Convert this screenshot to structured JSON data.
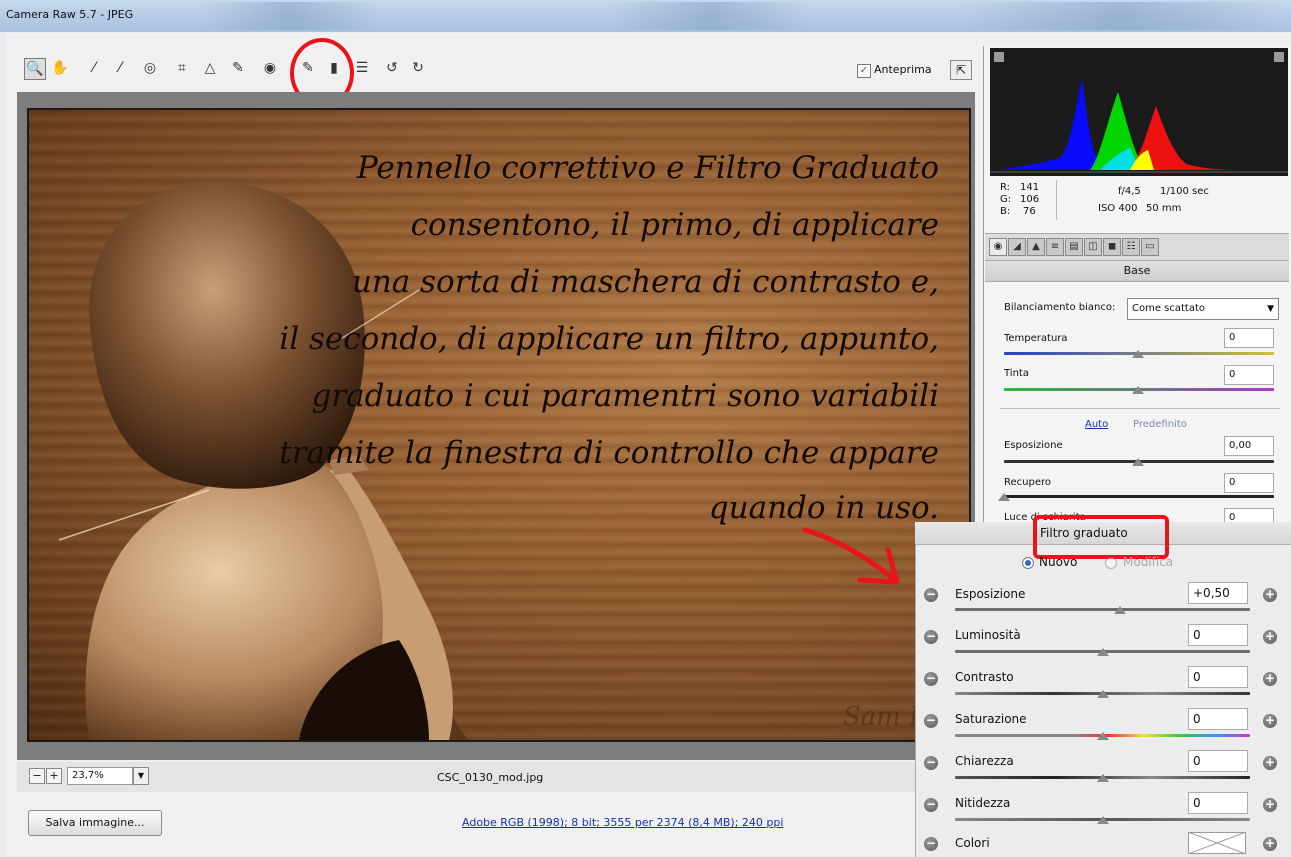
{
  "window": {
    "title": "Camera Raw 5.7  -  JPEG"
  },
  "toolbar": {
    "tools": [
      {
        "name": "zoom-tool",
        "glyph": "🔍"
      },
      {
        "name": "hand-tool",
        "glyph": "✋"
      },
      {
        "name": "white-balance-tool",
        "glyph": "⁄"
      },
      {
        "name": "color-sampler-tool",
        "glyph": "⁄"
      },
      {
        "name": "targeted-adjustment-tool",
        "glyph": "◎"
      },
      {
        "name": "crop-tool",
        "glyph": "⌗"
      },
      {
        "name": "straighten-tool",
        "glyph": "△"
      },
      {
        "name": "spot-removal-tool",
        "glyph": "✎"
      },
      {
        "name": "red-eye-tool",
        "glyph": "◉"
      },
      {
        "name": "adjustment-brush-tool",
        "glyph": "✎"
      },
      {
        "name": "graduated-filter-tool",
        "glyph": "▮"
      },
      {
        "name": "preferences-tool",
        "glyph": "☰"
      },
      {
        "name": "rotate-ccw-tool",
        "glyph": "↺"
      },
      {
        "name": "rotate-cw-tool",
        "glyph": "↻"
      }
    ],
    "preview_label": "Anteprima",
    "preview_checked": "✓"
  },
  "canvas": {
    "caption_lines": [
      "Pennello correttivo e Filtro Graduato",
      "consentono, il primo, di applicare",
      "una sorta di maschera di contrasto e,",
      "il secondo, di applicare un filtro, appunto,",
      "graduato i cui paramentri sono variabili",
      "tramite la finestra di controllo che appare",
      "quando in uso."
    ],
    "signature": "Sam DiG",
    "zoom_value": "23,7%",
    "filename": "CSC_0130_mod.jpg"
  },
  "footer": {
    "save_label": "Salva immagine...",
    "workflow_link": "Adobe RGB (1998); 8 bit; 3555 per 2374 (8,4 MB); 240 ppi"
  },
  "readout": {
    "r_label": "R:",
    "r_value": "141",
    "g_label": "G:",
    "g_value": "106",
    "b_label": "B:",
    "b_value": "76",
    "aperture": "f/4,5",
    "shutter": "1/100 sec",
    "iso": "ISO 400",
    "focal": "50 mm"
  },
  "panel": {
    "tabs": [
      "basic-tab",
      "tone-curve-tab",
      "detail-tab",
      "hsl-tab",
      "split-tone-tab",
      "lens-tab",
      "effects-tab",
      "camera-calibration-tab",
      "presets-tab"
    ],
    "section_title": "Base",
    "wb_label": "Bilanciamento bianco:",
    "wb_value": "Come scattato",
    "temperatura_label": "Temperatura",
    "temperatura_value": "0",
    "tinta_label": "Tinta",
    "tinta_value": "0",
    "auto_label": "Auto",
    "default_label": "Predefinito",
    "esposizione_label": "Esposizione",
    "esposizione_value": "0,00",
    "recupero_label": "Recupero",
    "recupero_value": "0",
    "luce_label": "Luce di schiarita",
    "luce_value": "0"
  },
  "graduated_filter": {
    "title": "Filtro graduato",
    "mode_new": "Nuovo",
    "mode_edit": "Modifica",
    "sliders": [
      {
        "label": "Esposizione",
        "value": "+0,50"
      },
      {
        "label": "Luminosità",
        "value": "0"
      },
      {
        "label": "Contrasto",
        "value": "0"
      },
      {
        "label": "Saturazione",
        "value": "0"
      },
      {
        "label": "Chiarezza",
        "value": "0"
      },
      {
        "label": "Nitidezza",
        "value": "0"
      },
      {
        "label": "Colori",
        "value": ""
      }
    ]
  },
  "colors": {
    "annotation_red": "#e8141a",
    "link_blue": "#1530b8"
  }
}
